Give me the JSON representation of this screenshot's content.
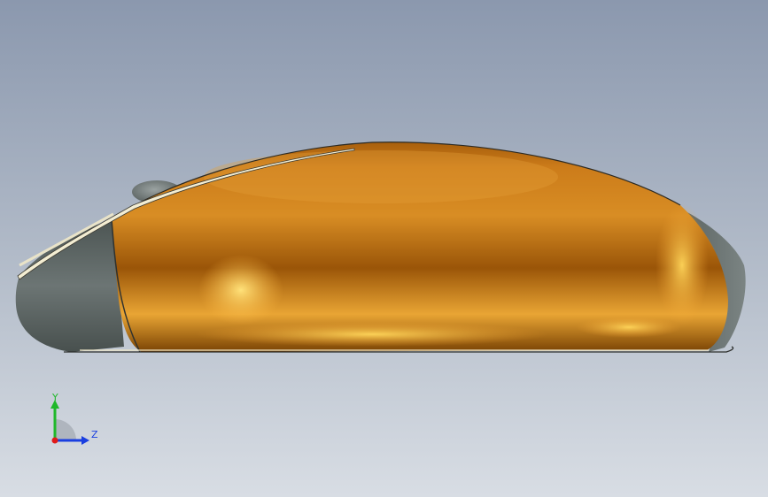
{
  "viewport": {
    "background_top": "#8e9bb0",
    "background_bottom": "#d6dbe2",
    "model": {
      "part": "mouse-shell",
      "body_color": "#c9781a",
      "highlight_color": "#ffd45a",
      "shadow_color": "#8a4a05",
      "trim_color": "#5e6766"
    }
  },
  "triad": {
    "x_label": "",
    "y_label": "Y",
    "z_label": "Z",
    "y_color": "#1fb82a",
    "z_color": "#1a3fe0",
    "x_color": "#e01a1a"
  }
}
